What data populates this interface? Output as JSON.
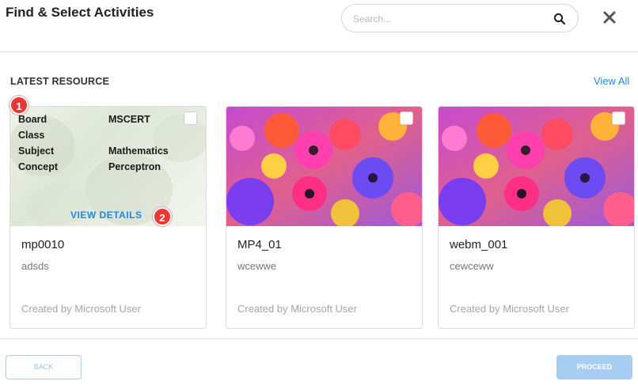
{
  "header": {
    "title": "Find & Select Activities",
    "search_placeholder": "Search...",
    "search_icon": "search-icon",
    "close_icon": "close-icon"
  },
  "section": {
    "label": "LATEST RESOURCE",
    "view_all": "View All"
  },
  "cards": [
    {
      "name": "mp0010",
      "description": "adsds",
      "creator": "Created by Microsoft User",
      "details": [
        {
          "key": "Board",
          "value": "MSCERT"
        },
        {
          "key": "Class",
          "value": ""
        },
        {
          "key": "Subject",
          "value": "Mathematics"
        },
        {
          "key": "Concept",
          "value": "Perceptron"
        }
      ],
      "view_details": "VIEW DETAILS"
    },
    {
      "name": "MP4_01",
      "description": "wcewwe",
      "creator": "Created by Microsoft User"
    },
    {
      "name": "webm_001",
      "description": "cewceww",
      "creator": "Created by Microsoft User"
    }
  ],
  "badges": [
    "1",
    "2"
  ],
  "footer": {
    "back_label": "BACK",
    "proceed_label": "PROCEED"
  },
  "colors": {
    "accent": "#1e88e5",
    "badge": "#e53935",
    "proceed_bg": "#a7cdf2"
  }
}
